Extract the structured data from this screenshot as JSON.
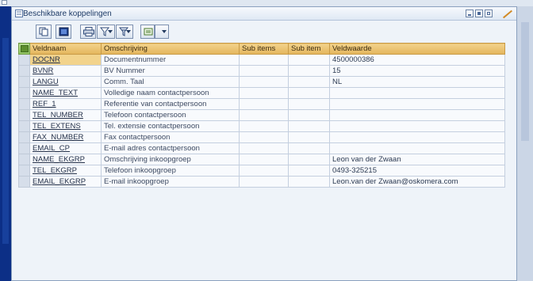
{
  "window": {
    "title": "Beschikbare koppelingen"
  },
  "toolbar": {
    "icons": [
      "copy-icon",
      "select-icon",
      "print-icon",
      "filter-icon",
      "sum-icon",
      "export-icon"
    ]
  },
  "table": {
    "columns": [
      "Veldnaam",
      "Omschrijving",
      "Sub items",
      "Sub item",
      "Veldwaarde"
    ],
    "rows": [
      {
        "veldnaam": "DOCNR",
        "omschrijving": "Documentnummer",
        "veldwaarde": "4500000386"
      },
      {
        "veldnaam": "BVNR",
        "omschrijving": "BV Nummer",
        "veldwaarde": "15"
      },
      {
        "veldnaam": "LANGU",
        "omschrijving": "Comm. Taal",
        "veldwaarde": "NL"
      },
      {
        "veldnaam": "NAME_TEXT",
        "omschrijving": "Volledige naam contactpersoon",
        "veldwaarde": ""
      },
      {
        "veldnaam": "REF_1",
        "omschrijving": "Referentie van contactpersoon",
        "veldwaarde": ""
      },
      {
        "veldnaam": "TEL_NUMBER",
        "omschrijving": "Telefoon contactpersoon",
        "veldwaarde": ""
      },
      {
        "veldnaam": "TEL_EXTENS",
        "omschrijving": "Tel. extensie contactpersoon",
        "veldwaarde": ""
      },
      {
        "veldnaam": "FAX_NUMBER",
        "omschrijving": "Fax contactpersoon",
        "veldwaarde": ""
      },
      {
        "veldnaam": "EMAIL_CP",
        "omschrijving": "E-mail adres contactpersoon",
        "veldwaarde": ""
      },
      {
        "veldnaam": "NAME_EKGRP",
        "omschrijving": "Omschrijving inkoopgroep",
        "veldwaarde": "Leon van der Zwaan"
      },
      {
        "veldnaam": "TEL_EKGRP",
        "omschrijving": "Telefoon inkoopgroep",
        "veldwaarde": "0493-325215"
      },
      {
        "veldnaam": "EMAIL_EKGRP",
        "omschrijving": "E-mail inkoopgroep",
        "veldwaarde": "Leon.van der Zwaan@oskomera.com"
      }
    ]
  }
}
